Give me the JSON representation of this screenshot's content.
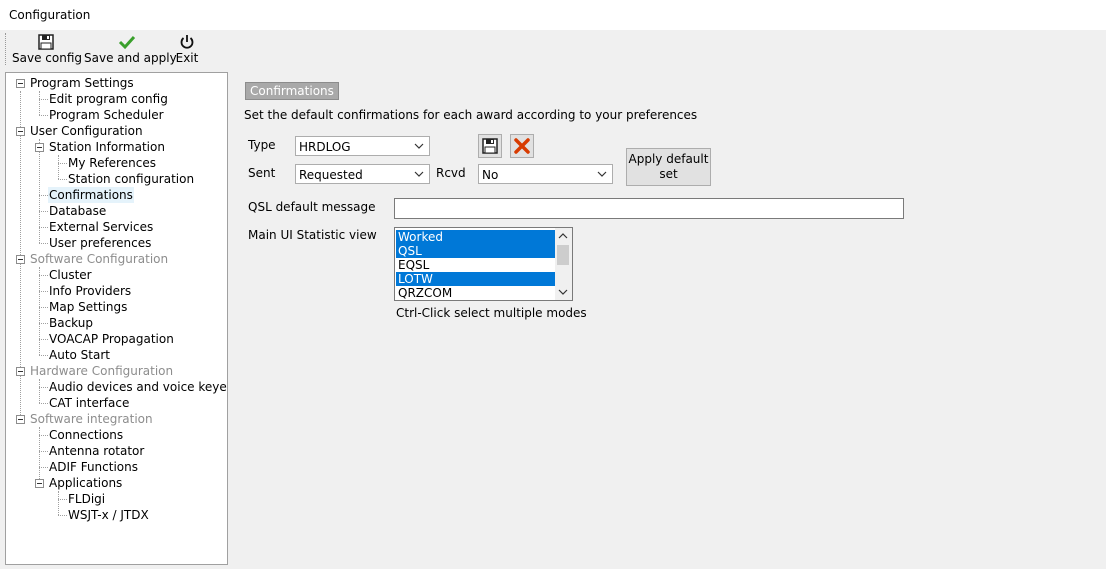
{
  "window": {
    "title": "Configuration"
  },
  "toolbar": {
    "save_config": "Save config",
    "save_apply": "Save and apply",
    "exit": "Exit",
    "icons": [
      "floppy-disk-icon",
      "checkmark-icon",
      "power-icon"
    ]
  },
  "tree": {
    "program_settings": "Program Settings",
    "edit_program_config": "Edit program config",
    "program_scheduler": "Program Scheduler",
    "user_configuration": "User Configuration",
    "station_information": "Station Information",
    "my_references": "My References",
    "station_configuration": "Station configuration",
    "confirmations": "Confirmations",
    "database": "Database",
    "external_services": "External Services",
    "user_preferences": "User preferences",
    "software_configuration": "Software Configuration",
    "cluster": "Cluster",
    "info_providers": "Info Providers",
    "map_settings": "Map Settings",
    "backup": "Backup",
    "voacap_propagation": "VOACAP Propagation",
    "auto_start": "Auto Start",
    "hardware_configuration": "Hardware Configuration",
    "audio_devices": "Audio devices and voice keyer",
    "cat_interface": "CAT interface",
    "software_integration": "Software integration",
    "connections": "Connections",
    "antenna_rotator": "Antenna rotator",
    "adif_functions": "ADIF Functions",
    "applications": "Applications",
    "fldigi": "FLDigi",
    "wsjtx": "WSJT-x / JTDX"
  },
  "panel": {
    "title": "Confirmations",
    "description": "Set the default confirmations for each award according to your preferences",
    "type_label": "Type",
    "type_value": "HRDLOG",
    "sent_label": "Sent",
    "sent_value": "Requested",
    "rcvd_label": "Rcvd",
    "rcvd_value": "No",
    "apply_default_line1": "Apply default",
    "apply_default_line2": "set",
    "qsl_label": "QSL default message",
    "qsl_value": "",
    "stat_label": "Main UI Statistic view",
    "stat_items": [
      {
        "label": "Worked",
        "selected": true
      },
      {
        "label": "QSL",
        "selected": true
      },
      {
        "label": "EQSL",
        "selected": false
      },
      {
        "label": "LOTW",
        "selected": true
      },
      {
        "label": "QRZCOM",
        "selected": false
      }
    ],
    "hint": "Ctrl-Click select multiple modes"
  },
  "colors": {
    "selection": "#0078d7",
    "accent_red": "#d83b01"
  }
}
